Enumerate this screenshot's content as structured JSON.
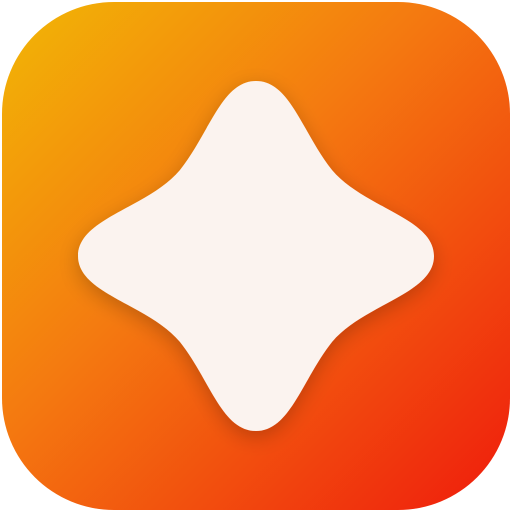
{
  "icon": {
    "name": "sparkle-icon",
    "gradient": {
      "start": "#F2B705",
      "mid": "#F47A10",
      "end": "#EF1B0C"
    },
    "glyph_color": "#FBF3EF"
  }
}
